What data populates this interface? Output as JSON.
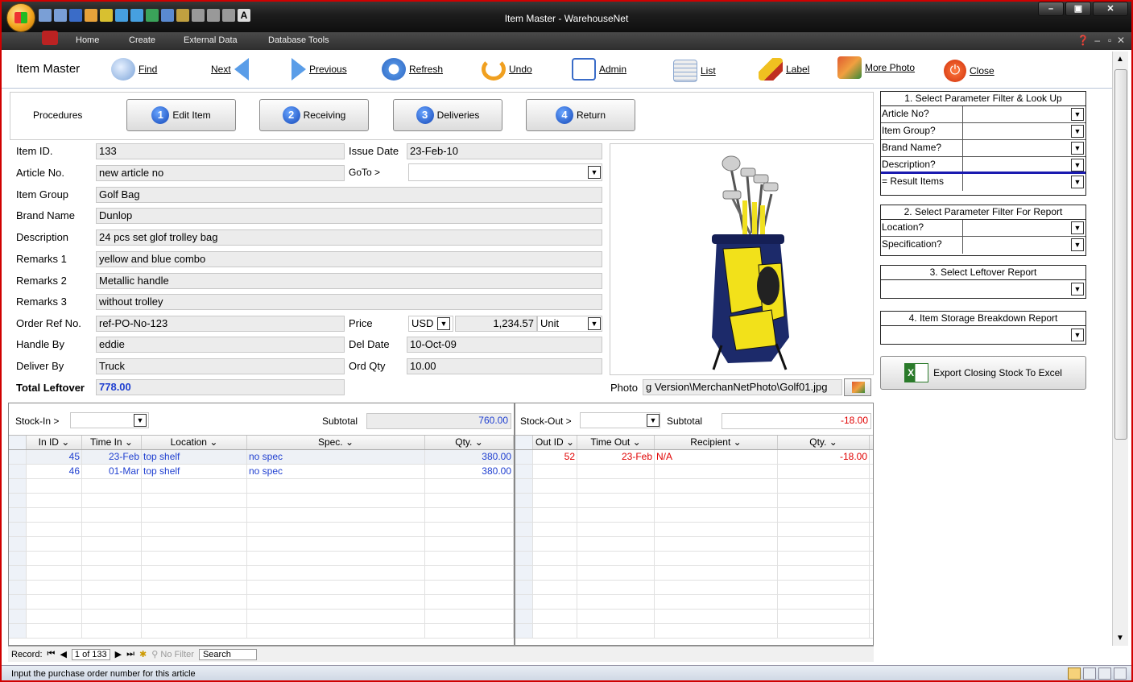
{
  "window": {
    "title": "Item Master - WarehouseNet"
  },
  "ribbon_tabs": [
    "Home",
    "Create",
    "External Data",
    "Database Tools"
  ],
  "toolbar": {
    "form_title": "Item Master",
    "find": "Find",
    "next": "Next",
    "previous": "Previous",
    "refresh": "Refresh",
    "undo": "Undo",
    "admin": "Admin",
    "list": "List",
    "label": "Label",
    "more_photo": "More Photo",
    "close": "Close"
  },
  "procedures": {
    "label": "Procedures",
    "buttons": [
      {
        "num": "1",
        "label": "Edit Item"
      },
      {
        "num": "2",
        "label": "Receiving"
      },
      {
        "num": "3",
        "label": "Deliveries"
      },
      {
        "num": "4",
        "label": "Return"
      }
    ]
  },
  "item": {
    "labels": {
      "item_id": "Item ID.",
      "article_no": "Article No.",
      "item_group": "Item Group",
      "brand_name": "Brand Name",
      "description": "Description",
      "remarks1": "Remarks 1",
      "remarks2": "Remarks 2",
      "remarks3": "Remarks 3",
      "order_ref": "Order Ref No.",
      "handle_by": "Handle By",
      "deliver_by": "Deliver By",
      "total_leftover": "Total Leftover",
      "issue_date": "Issue Date",
      "goto": "GoTo >",
      "price": "Price",
      "del_date": "Del Date",
      "ord_qty": "Ord Qty",
      "photo": "Photo"
    },
    "item_id": "133",
    "article_no": "new article no",
    "item_group": "Golf Bag",
    "brand_name": "Dunlop",
    "description": "24 pcs set glof trolley bag",
    "remarks1": "yellow and blue combo",
    "remarks2": "Metallic handle",
    "remarks3": "without trolley",
    "order_ref": "ref-PO-No-123",
    "handle_by": "eddie",
    "deliver_by": "Truck",
    "total_leftover": "778.00",
    "issue_date": "23-Feb-10",
    "goto": "",
    "currency": "USD",
    "price": "1,234.57",
    "unit": "Unit",
    "del_date": "10-Oct-09",
    "ord_qty": "10.00",
    "photo_path": "g Version\\MerchanNetPhoto\\Golf01.jpg"
  },
  "right_panel": {
    "section1": {
      "title": "1. Select Parameter Filter & Look Up",
      "rows": [
        "Article No?",
        "Item Group?",
        "Brand Name?",
        "Description?"
      ],
      "result": "= Result Items"
    },
    "section2": {
      "title": "2. Select Parameter Filter For Report",
      "rows": [
        "Location?",
        "Specification?"
      ]
    },
    "section3": {
      "title": "3. Select Leftover Report"
    },
    "section4": {
      "title": "4. Item Storage Breakdown Report"
    },
    "export_button": "Export Closing Stock To Excel"
  },
  "stock_in": {
    "label": "Stock-In >",
    "subtotal_label": "Subtotal",
    "subtotal": "760.00",
    "columns": [
      "In ID",
      "Time In",
      "Location",
      "Spec.",
      "Qty."
    ],
    "rows": [
      {
        "id": "45",
        "time": "23-Feb",
        "location": "top shelf",
        "spec": "no spec",
        "qty": "380.00"
      },
      {
        "id": "46",
        "time": "01-Mar",
        "location": "top shelf",
        "spec": "no spec",
        "qty": "380.00"
      }
    ]
  },
  "stock_out": {
    "label": "Stock-Out >",
    "subtotal_label": "Subtotal",
    "subtotal": "-18.00",
    "columns": [
      "Out ID",
      "Time Out",
      "Recipient",
      "Qty."
    ],
    "rows": [
      {
        "id": "52",
        "time": "23-Feb",
        "recipient": "N/A",
        "qty": "-18.00"
      }
    ]
  },
  "record_nav": {
    "label": "Record:",
    "position": "1 of 133",
    "filter": "No Filter",
    "search": "Search"
  },
  "status": {
    "text": "Input the purchase order number for this article"
  },
  "colors": {
    "accent_blue": "#1f3fd0",
    "negative_red": "#e00000",
    "frame_red": "#d00000"
  }
}
